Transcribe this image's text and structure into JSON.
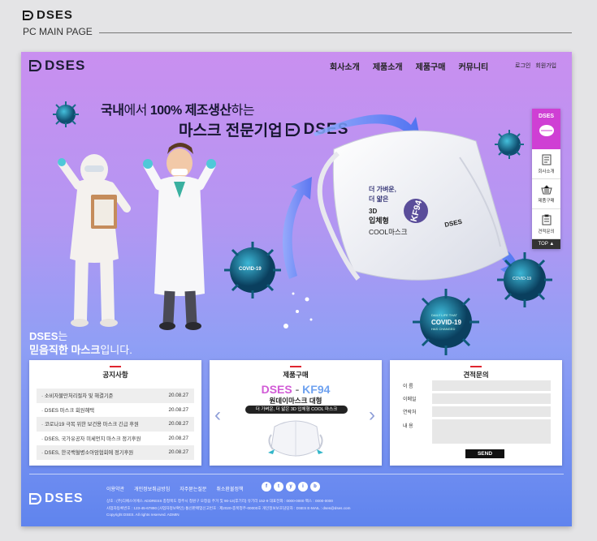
{
  "top": {
    "logo": "DSES",
    "subtitle": "PC MAIN PAGE"
  },
  "header": {
    "logo": "DSES",
    "nav": [
      "회사소개",
      "제품소개",
      "제품구매",
      "커뮤니티"
    ],
    "login": "로그인",
    "join": "회원가입"
  },
  "hero": {
    "line1_a": "국내",
    "line1_b": "에서 ",
    "line1_c": "100% 제조생산",
    "line1_d": "하는",
    "line2": "마스크 전문기업",
    "brand": "DSES",
    "mask_copy1": "더 가벼운,",
    "mask_copy2": "더 얇은",
    "mask_copy3": "3D",
    "mask_copy4": "입체형",
    "mask_copy5": "COOL마스크",
    "mask_badge": "KF94",
    "mask_brand": "DSES",
    "virus_label": "COVID-19",
    "virus_sub1": "DAILY LIFE THAT",
    "virus_sub2": "HAS CHANGED",
    "tagline1_a": "DSES",
    "tagline1_b": "는",
    "tagline2_a": "믿음직한 마스크",
    "tagline2_b": "입니다."
  },
  "side": {
    "logo": "DSES",
    "items": [
      "회사소개",
      "제품구매",
      "견적문의"
    ],
    "top": "TOP ▲"
  },
  "notice": {
    "title": "공지사항",
    "items": [
      {
        "text": "소비자불만처리절차 및 해결기준",
        "date": "20.08.27"
      },
      {
        "text": "DSES 마스크 회원혜택",
        "date": "20.08.27"
      },
      {
        "text": "코로나19 극복 위한 보건용 마스크 긴급 후원",
        "date": "20.08.27"
      },
      {
        "text": "DSES, 국가유공자 미세먼지 마스크 정기후원",
        "date": "20.08.27"
      },
      {
        "text": "DSES, 한국백혈병소아암협회에 정기후원",
        "date": "20.08.27"
      }
    ]
  },
  "product": {
    "title": "제품구매",
    "name_a": "DSES",
    "name_b": " - ",
    "name_c": "KF94",
    "sub": "원데이마스크 대형",
    "pill": "더 가벼운, 더 얇은 3D 입체형 COOL 마스크",
    "prev": "‹",
    "next": "›"
  },
  "quote": {
    "title": "견적문의",
    "fields": [
      "이 름",
      "이메일",
      "연락처",
      "내 용"
    ],
    "send": "SEND"
  },
  "footer": {
    "logo": "DSES",
    "links": [
      "이용약관",
      "개인정보취급방침",
      "자주묻는질문",
      "취소환불정책"
    ],
    "social": [
      "f",
      "t",
      "y",
      "i",
      "b"
    ],
    "info1": "상호 : (주)디에스이에스  ADDRESS 충청북도 청주시 청원구 오창읍 주거 및 90-13(후기리) 유기리 152-9    대표전화 : 0000-0000    팩스 : 0000-0000",
    "info2": "사업자등록번호 : 123-45-67890 (사업자정보확인)    통신판매업신고번호 : 제2020-충북청주-00000호    개인정보보호담당자 : DSES    E-MAIL : dses@dses.com",
    "info3": "Copyright DSES. All rights reserved. ADMIN"
  },
  "colors": {
    "accent": "#e0252f",
    "brand_pink": "#cf3fd4",
    "kf_purple": "#4a3f8a"
  }
}
